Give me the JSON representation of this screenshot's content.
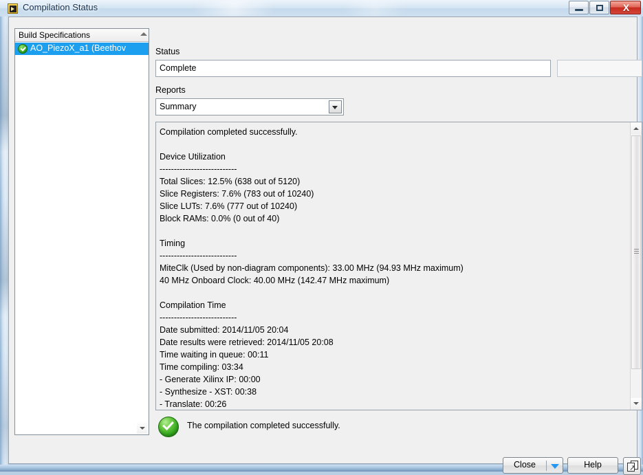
{
  "window": {
    "title": "Compilation Status",
    "icon": "labview-fpga-icon",
    "controls": {
      "minimize": "minimize-icon",
      "maximize": "restore-icon",
      "close_glyph": "X"
    }
  },
  "tree_panel": {
    "header": "Build Specifications",
    "items": [
      {
        "label": "AO_PiezoX_a1 (Beethov",
        "status_icon": "green-check-icon",
        "selected": true
      }
    ]
  },
  "status": {
    "label": "Status",
    "value": "Complete",
    "progress_value": ""
  },
  "reports": {
    "label": "Reports",
    "selected": "Summary",
    "options": [
      "Summary"
    ]
  },
  "report_text": "Compilation completed successfully.\n\nDevice Utilization\n---------------------------\nTotal Slices: 12.5% (638 out of 5120)\nSlice Registers: 7.6% (783 out of 10240)\nSlice LUTs: 7.6% (777 out of 10240)\nBlock RAMs: 0.0% (0 out of 40)\n\nTiming\n---------------------------\nMiteClk (Used by non-diagram components): 33.00 MHz (94.93 MHz maximum)\n40 MHz Onboard Clock: 40.00 MHz (142.47 MHz maximum)\n\nCompilation Time\n---------------------------\nDate submitted: 2014/11/05 20:04\nDate results were retrieved: 2014/11/05 20:08\nTime waiting in queue: 00:11\nTime compiling: 03:34\n- Generate Xilinx IP: 00:00\n- Synthesize - XST: 00:38\n- Translate: 00:26",
  "report_details": {
    "headline": "Compilation completed successfully.",
    "device_utilization": {
      "title": "Device Utilization",
      "rows": [
        "Total Slices: 12.5% (638 out of 5120)",
        "Slice Registers: 7.6% (783 out of 10240)",
        "Slice LUTs: 7.6% (777 out of 10240)",
        "Block RAMs: 0.0% (0 out of 40)"
      ]
    },
    "timing": {
      "title": "Timing",
      "rows": [
        "MiteClk (Used by non-diagram components): 33.00 MHz (94.93 MHz maximum)",
        "40 MHz Onboard Clock: 40.00 MHz (142.47 MHz maximum)"
      ]
    },
    "compilation_time": {
      "title": "Compilation Time",
      "rows": [
        "Date submitted: 2014/11/05 20:04",
        "Date results were retrieved: 2014/11/05 20:08",
        "Time waiting in queue: 00:11",
        "Time compiling: 03:34",
        "- Generate Xilinx IP: 00:00",
        "- Synthesize - XST: 00:38",
        "- Translate: 00:26"
      ]
    }
  },
  "footer": {
    "success_message": "The compilation completed successfully.",
    "success_icon": "green-check-circle-icon",
    "close_button": "Close",
    "help_button": "Help",
    "detach_button_icon": "detach-window-icon"
  },
  "colors": {
    "selection_blue": "#1c9fee",
    "success_green": "#35a81f",
    "dropdown_arrow_blue": "#2196f3",
    "close_button_red": "#c62b1e",
    "dialog_bg": "#f0f0f0"
  }
}
